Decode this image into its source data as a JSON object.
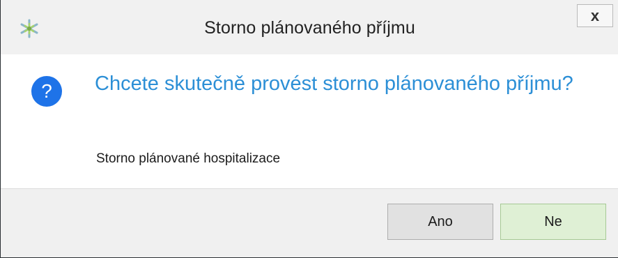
{
  "window": {
    "title": "Storno plánovaného příjmu",
    "app_icon": "snowflake-app-icon",
    "close_label": "x"
  },
  "message": {
    "icon": "question-icon",
    "icon_glyph": "?",
    "question": "Chcete skutečně provést storno plánovaného příjmu?",
    "detail": "Storno plánované hospitalizace"
  },
  "buttons": {
    "yes_label": "Ano",
    "no_label": "Ne"
  },
  "colors": {
    "question_text": "#2c8fd6",
    "question_icon": "#1e73e8",
    "default_button": "#dff0d5"
  }
}
